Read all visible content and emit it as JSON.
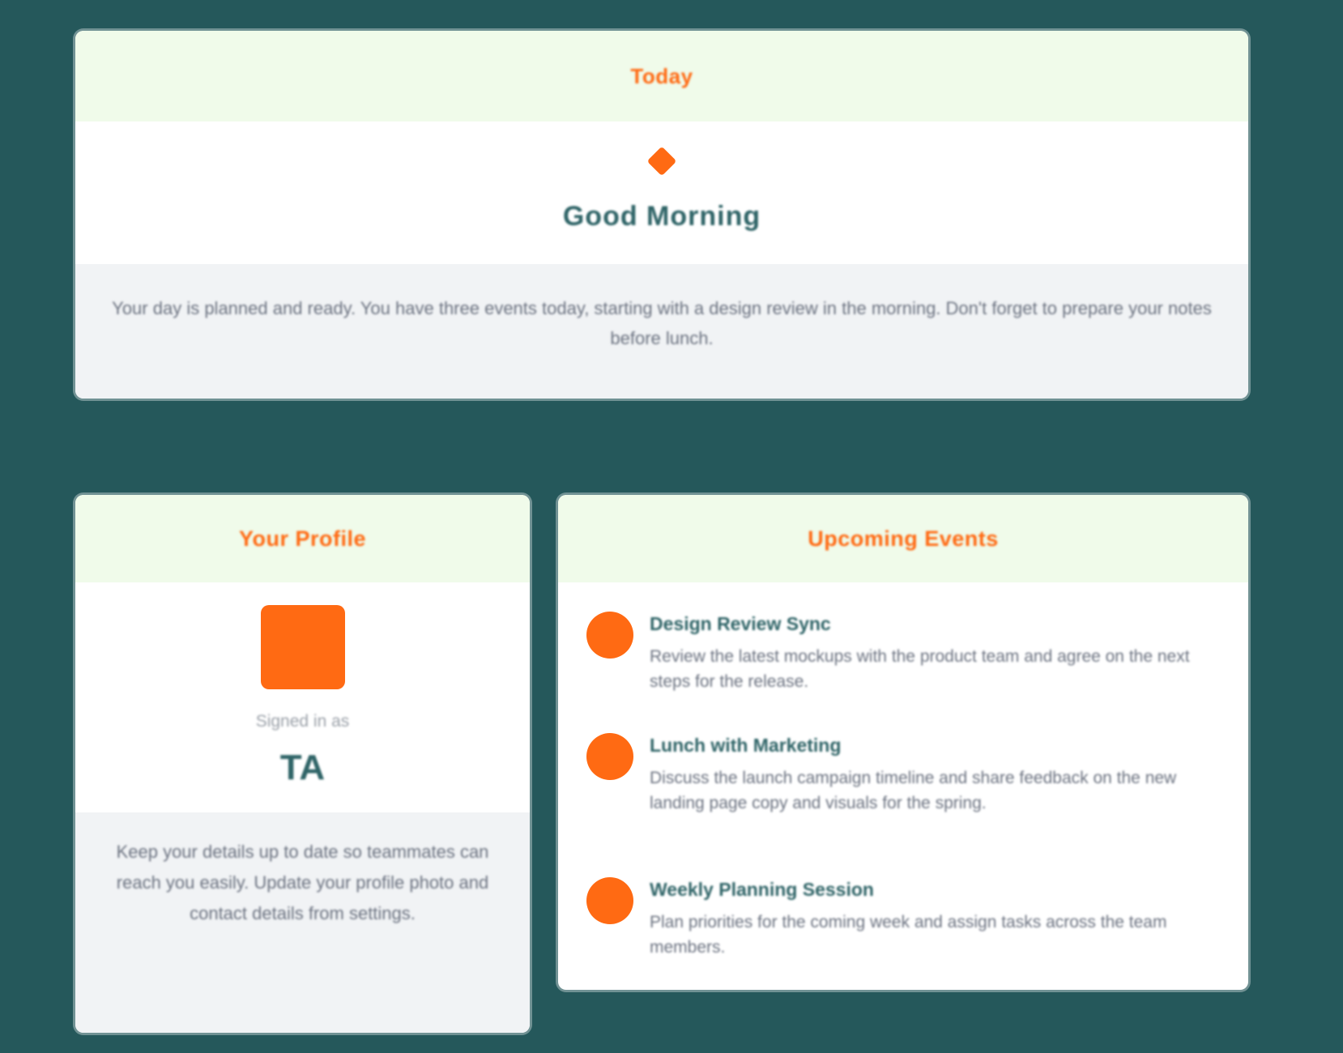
{
  "top_card": {
    "header": "Today",
    "headline": "Good Morning",
    "footer_text": "Your day is planned and ready. You have three events today, starting with a design review in the morning. Don't forget to prepare your notes before lunch."
  },
  "profile_card": {
    "header": "Your Profile",
    "caption": "Signed in as",
    "initials": "TA",
    "footer_text": "Keep your details up to date so teammates can reach you easily. Update your profile photo and contact details from settings."
  },
  "events_card": {
    "header": "Upcoming Events",
    "events": [
      {
        "title": "Design Review Sync",
        "description": "Review the latest mockups with the product team and agree on the next steps for the release."
      },
      {
        "title": "Lunch with Marketing",
        "description": "Discuss the launch campaign timeline and share feedback on the new landing page copy and visuals for the spring."
      },
      {
        "title": "Weekly Planning Session",
        "description": "Plan priorities for the coming week and assign tasks across the team members."
      }
    ]
  },
  "colors": {
    "background": "#25585b",
    "accent": "#ff6a13",
    "header_tint": "#f0fbea",
    "footer_gray": "#f1f3f5",
    "heading_teal": "#2f6467"
  }
}
